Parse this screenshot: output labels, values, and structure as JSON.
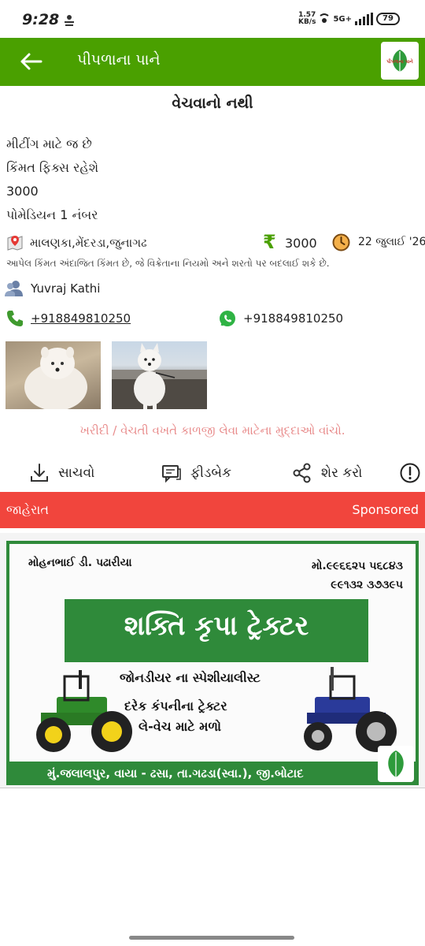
{
  "status_bar": {
    "time": "9:28",
    "speed_value": "1.57",
    "speed_unit": "KB/s",
    "network": "5G+",
    "battery": "79"
  },
  "header": {
    "title": "પીપળાના પાને",
    "logo_text": "પીપળાના પાને"
  },
  "post": {
    "title": "વેચવાનો નથી",
    "description": [
      "મીટીંગ માટે જ છે",
      "કિંમત ફિક્સ રહેશે",
      "3000",
      "પોમેડિયન 1 નંબર"
    ],
    "location": "માલણકા,મેંદરડા,જુનાગઢ",
    "currency_symbol": "₹",
    "price": "3000",
    "date": "22 જુલાઈ '26",
    "disclaimer": "આપેલ કિંમત અંદાજિત કિંમત છે, જે વિક્રેતાના નિયમો અને શરતો પર બદલાઈ શકે છે.",
    "seller": "Yuvraj Kathi",
    "phone": "+918849810250",
    "whatsapp": "+918849810250",
    "warning_link": "ખરીદી / વેચતી વખતે કાળજી લેવા માટેના મુદ્દાઓ વાંચો."
  },
  "actions": {
    "save": "સાચવો",
    "feedback": "ફીડબેક",
    "share": "શેર કરો"
  },
  "ad": {
    "label": "જાહેરાત",
    "sponsored": "Sponsored",
    "banner": {
      "owner": "મોહનભાઈ ડી. પઢારીયા",
      "mobile_1": "મો.૯૯૬૬૨૫ ૫૬૮૪૩",
      "mobile_2": "૯૯૧૩૨ ૩૭૩૯૫",
      "title": "શક્તિ કૃપા ટ્રેક્ટર",
      "line1": "જોનડીયર ના સ્પેશીયાલીસ્ટ",
      "line2": "દરેક કંપનીના ટ્રેક્ટર",
      "line3": "લે-વેચ માટે મળો",
      "address": "મું.જલાલપુર, વાયા - ઢસા, તા.ગઢડા(સ્વા.), જી.બોટાદ"
    }
  },
  "colors": {
    "header_green": "#4aa000",
    "ad_red": "#f1453d",
    "banner_green": "#2f8a3a"
  }
}
